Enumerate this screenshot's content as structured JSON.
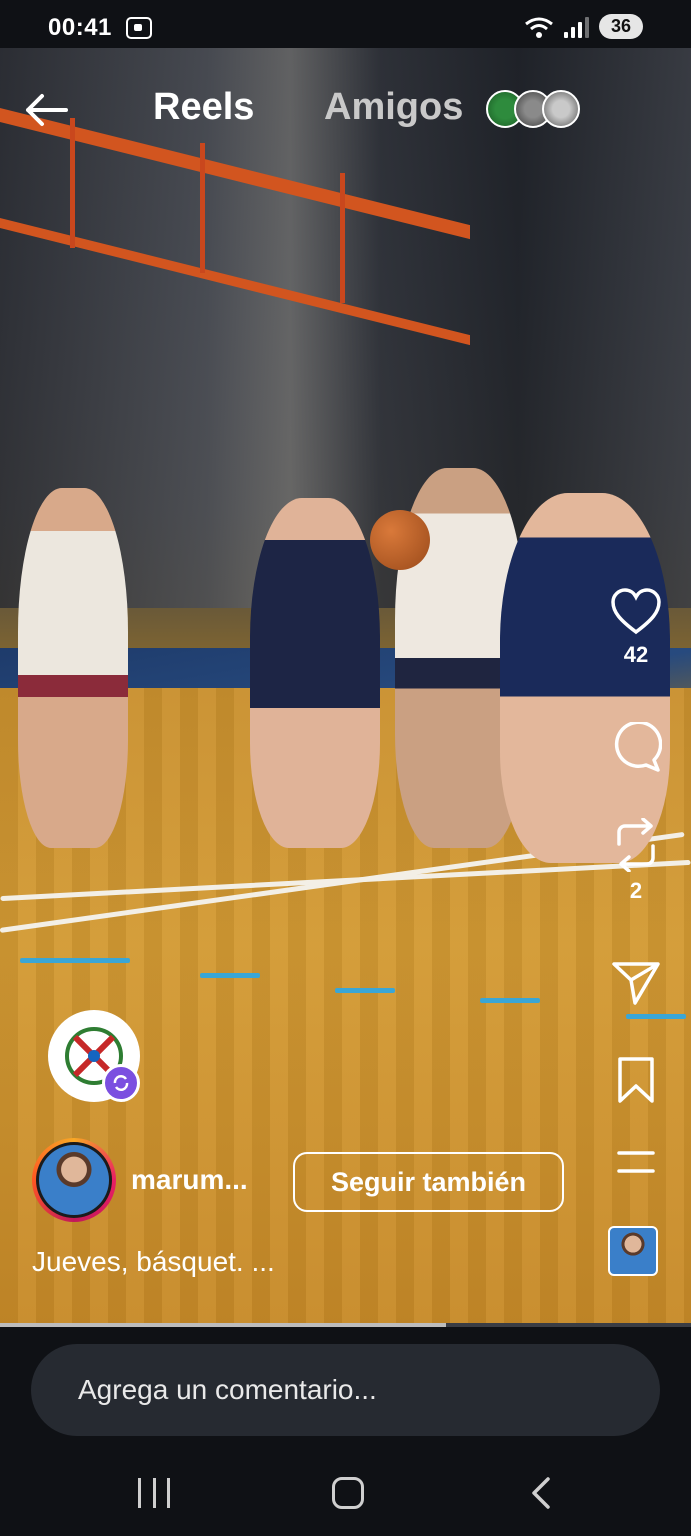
{
  "status_bar": {
    "time": "00:41",
    "battery": "36"
  },
  "header": {
    "title": "Reels",
    "friends_label": "Amigos"
  },
  "actions": {
    "likes": "42",
    "reposts": "2"
  },
  "post": {
    "username": "marum...",
    "follow_label": "Seguir también",
    "caption": "Jueves, básquet. ..."
  },
  "progress": {
    "fraction": 0.645
  },
  "comment": {
    "placeholder": "Agrega un comentario..."
  },
  "colors": {
    "follow_border": "#ffffff",
    "badge_purple": "#7b4fe0",
    "background": "#0f1115"
  }
}
